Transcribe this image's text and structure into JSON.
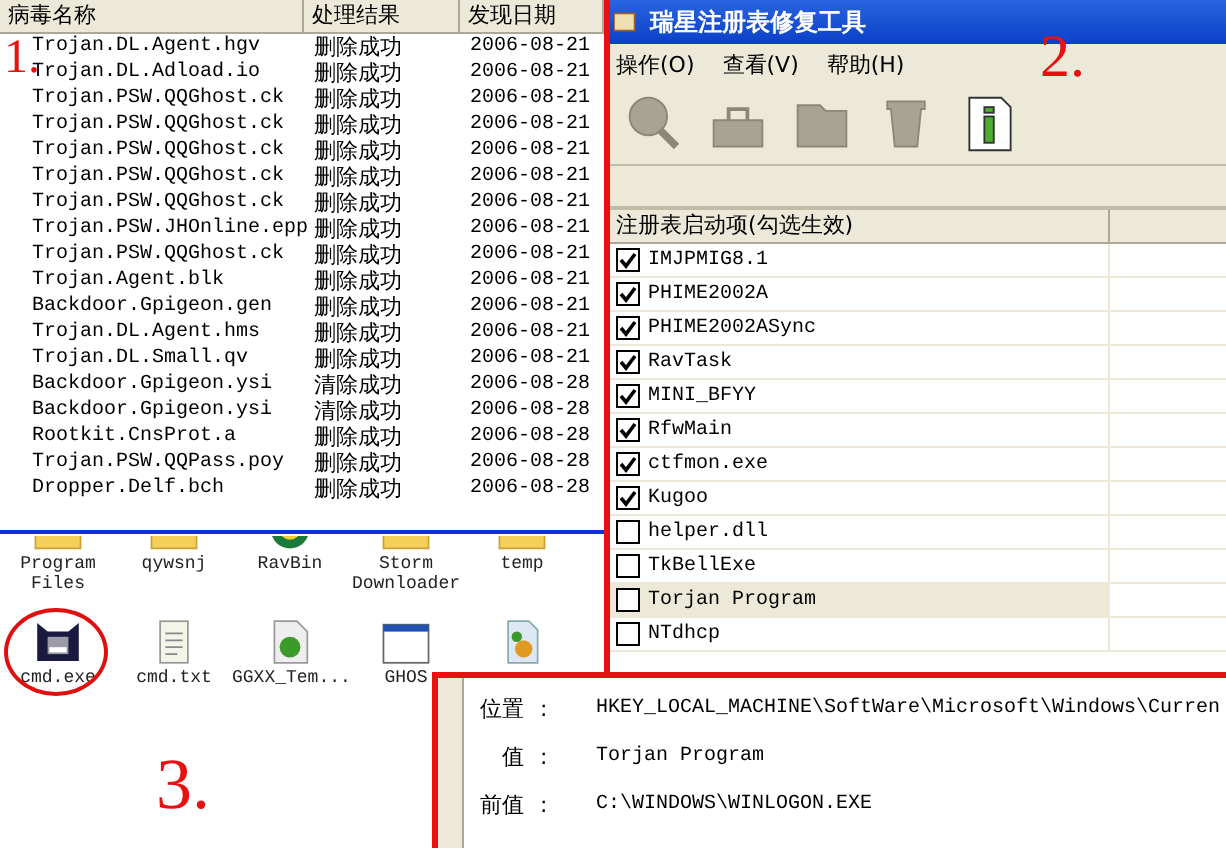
{
  "virus_log": {
    "marker": "1.",
    "columns": [
      "病毒名称",
      "处理结果",
      "发现日期"
    ],
    "rows": [
      {
        "name": "Trojan.DL.Agent.hgv",
        "result": "删除成功",
        "date": "2006-08-21"
      },
      {
        "name": "Trojan.DL.Adload.io",
        "result": "删除成功",
        "date": "2006-08-21"
      },
      {
        "name": "Trojan.PSW.QQGhost.ck",
        "result": "删除成功",
        "date": "2006-08-21"
      },
      {
        "name": "Trojan.PSW.QQGhost.ck",
        "result": "删除成功",
        "date": "2006-08-21"
      },
      {
        "name": "Trojan.PSW.QQGhost.ck",
        "result": "删除成功",
        "date": "2006-08-21"
      },
      {
        "name": "Trojan.PSW.QQGhost.ck",
        "result": "删除成功",
        "date": "2006-08-21"
      },
      {
        "name": "Trojan.PSW.QQGhost.ck",
        "result": "删除成功",
        "date": "2006-08-21"
      },
      {
        "name": "Trojan.PSW.JHOnline.epp",
        "result": "删除成功",
        "date": "2006-08-21"
      },
      {
        "name": "Trojan.PSW.QQGhost.ck",
        "result": "删除成功",
        "date": "2006-08-21"
      },
      {
        "name": "Trojan.Agent.blk",
        "result": "删除成功",
        "date": "2006-08-21"
      },
      {
        "name": "Backdoor.Gpigeon.gen",
        "result": "删除成功",
        "date": "2006-08-21"
      },
      {
        "name": "Trojan.DL.Agent.hms",
        "result": "删除成功",
        "date": "2006-08-21"
      },
      {
        "name": "Trojan.DL.Small.qv",
        "result": "删除成功",
        "date": "2006-08-21"
      },
      {
        "name": "Backdoor.Gpigeon.ysi",
        "result": "清除成功",
        "date": "2006-08-28"
      },
      {
        "name": "Backdoor.Gpigeon.ysi",
        "result": "清除成功",
        "date": "2006-08-28"
      },
      {
        "name": "Rootkit.CnsProt.a",
        "result": "删除成功",
        "date": "2006-08-28"
      },
      {
        "name": "Trojan.PSW.QQPass.poy",
        "result": "删除成功",
        "date": "2006-08-28"
      },
      {
        "name": "Dropper.Delf.bch",
        "result": "删除成功",
        "date": "2006-08-28"
      }
    ]
  },
  "registry_tool": {
    "marker": "2.",
    "title": "瑞星注册表修复工具",
    "menu": [
      "操作(O)",
      "查看(V)",
      "帮助(H)"
    ],
    "toolbar": [
      {
        "kind": "magnifier",
        "disabled": true
      },
      {
        "kind": "bag",
        "disabled": true
      },
      {
        "kind": "folder",
        "disabled": true
      },
      {
        "kind": "bin",
        "disabled": true
      },
      {
        "kind": "info",
        "disabled": false
      }
    ],
    "list_header": "注册表启动项(勾选生效)",
    "items": [
      {
        "name": "IMJPMIG8.1",
        "checked": true,
        "selected": false
      },
      {
        "name": "PHIME2002A",
        "checked": true,
        "selected": false
      },
      {
        "name": "PHIME2002ASync",
        "checked": true,
        "selected": false
      },
      {
        "name": "RavTask",
        "checked": true,
        "selected": false
      },
      {
        "name": "MINI_BFYY",
        "checked": true,
        "selected": false
      },
      {
        "name": "RfwMain",
        "checked": true,
        "selected": false
      },
      {
        "name": "ctfmon.exe",
        "checked": true,
        "selected": false
      },
      {
        "name": "Kugoo",
        "checked": true,
        "selected": false
      },
      {
        "name": "helper.dll",
        "checked": false,
        "selected": false
      },
      {
        "name": "TkBellExe",
        "checked": false,
        "selected": false
      },
      {
        "name": "Torjan Program",
        "checked": false,
        "selected": true
      },
      {
        "name": "NTdhcp",
        "checked": false,
        "selected": false
      }
    ]
  },
  "desktop": {
    "marker": "3.",
    "icons": [
      {
        "kind": "folder",
        "label": "Program Files",
        "circled": false
      },
      {
        "kind": "folder",
        "label": "qywsnj",
        "circled": false
      },
      {
        "kind": "app",
        "label": "RavBin",
        "circled": false
      },
      {
        "kind": "folder",
        "label": "Storm Downloader",
        "circled": false
      },
      {
        "kind": "folder",
        "label": "temp",
        "circled": false
      },
      {
        "kind": "monster",
        "label": "cmd.exe",
        "circled": true
      },
      {
        "kind": "text",
        "label": "cmd.txt",
        "circled": false
      },
      {
        "kind": "media",
        "label": "GGXX_Tem...",
        "circled": false
      },
      {
        "kind": "window",
        "label": "GHOS",
        "circled": false
      },
      {
        "kind": "setup",
        "circled": false
      }
    ]
  },
  "details": [
    {
      "label": "位置",
      "separator": ":",
      "value": "HKEY_LOCAL_MACHINE\\SoftWare\\Microsoft\\Windows\\Curren"
    },
    {
      "label": "值",
      "separator": ":",
      "value": "Torjan Program"
    },
    {
      "label": "前值",
      "separator": ":",
      "value": "C:\\WINDOWS\\WINLOGON.EXE"
    }
  ]
}
